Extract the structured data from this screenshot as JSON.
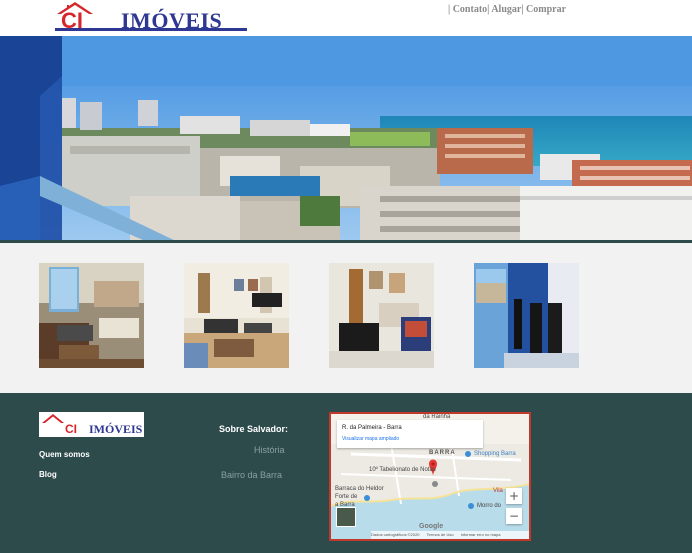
{
  "header": {
    "logo": {
      "mark_text": "CI",
      "word_text": "IMÓVEIS"
    },
    "nav": [
      {
        "label": "Contato"
      },
      {
        "label": "Alugar"
      },
      {
        "label": "Comprar"
      }
    ],
    "separator": "|"
  },
  "gallery": {
    "items": [
      {
        "alt": "living-room-with-balcony"
      },
      {
        "alt": "living-room"
      },
      {
        "alt": "dining-area"
      },
      {
        "alt": "balcony"
      }
    ]
  },
  "footer": {
    "logo": {
      "mark_text": "CI",
      "word_text": "IMÓVEIS"
    },
    "links": [
      {
        "label": "Quem somos"
      },
      {
        "label": "Blog"
      }
    ],
    "about_heading": "Sobre Salvador:",
    "about_links": [
      {
        "label": "História"
      },
      {
        "label": "Bairro da Barra"
      }
    ],
    "map": {
      "card_title": "R. da Palmeira - Barra",
      "card_link": "Visualizar mapa ampliado",
      "labels": {
        "barra": "BARRA",
        "shopping": "Shopping Barra",
        "tabelionato": "10º Tabelionato de Notas",
        "barraca": "Barraca do Heldor",
        "forte": "Forte de",
        "barra_forte": "a Barra",
        "morro": "Morro do",
        "vila": "Vila",
        "rua": "da Rainha"
      },
      "zoom_in": "+",
      "zoom_out": "−",
      "google": "Google",
      "footer_items": [
        "Dados cartográficos ©2020",
        "Termos de Uso",
        "Informar erro no mapa"
      ]
    }
  },
  "colors": {
    "brand_red": "#d6262b",
    "brand_blue": "#2e3791",
    "footer_bg": "#2e4b4c",
    "gallery_bg": "#f2f2f2",
    "map_border": "#c0392b"
  }
}
